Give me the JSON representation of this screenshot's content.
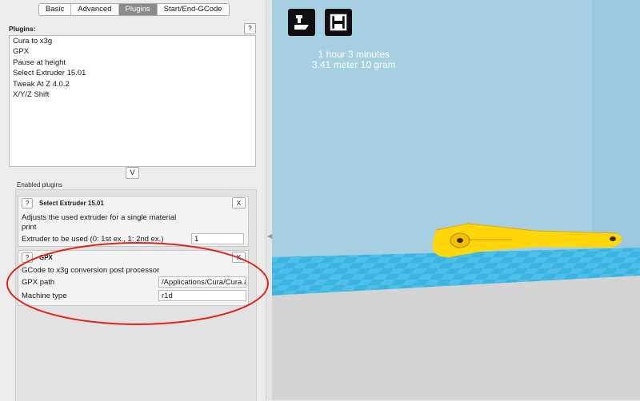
{
  "tabs": [
    "Basic",
    "Advanced",
    "Plugins",
    "Start/End-GCode"
  ],
  "active_tab": "Plugins",
  "plugins_section": {
    "label": "Plugins:",
    "help": "?",
    "items": [
      "Cura to x3g",
      "GPX",
      "Pause at height",
      "Select Extruder 15.01",
      "Tweak At Z 4.0.2",
      "X/Y/Z Shift"
    ]
  },
  "expand_button": "V",
  "enabled_label": "Enabled plugins",
  "cards": {
    "select_extruder": {
      "help": "?",
      "title": "Select Extruder 15.01",
      "close": "X",
      "description_line1": "Adjusts the used extruder for a single material",
      "description_line2": "print",
      "param_label": "Extruder to be used (0: 1st ex., 1: 2nd ex.)",
      "param_value": "1"
    },
    "gpx": {
      "help": "?",
      "title": "GPX",
      "close": "X",
      "description": "GCode to x3g conversion post processor",
      "path_label": "GPX path",
      "path_value": "/Applications/Cura/Cura.app",
      "machine_label": "Machine type",
      "machine_value": "r1d"
    }
  },
  "viewport": {
    "print_time": "1 hour 3 minutes",
    "material": "3.41 meter 10 gram",
    "platform_color": "#4cc0ea",
    "model_color": "#ffd60a",
    "annotation_color": "#e3241b"
  }
}
